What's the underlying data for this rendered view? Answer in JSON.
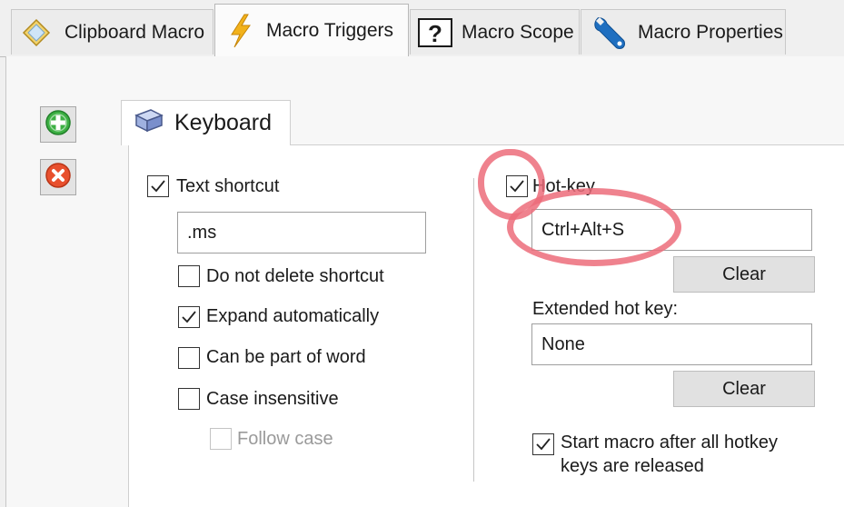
{
  "tabs": [
    {
      "label": "Clipboard Macro",
      "icon": "diamond-icon",
      "active": false
    },
    {
      "label": "Macro Triggers",
      "icon": "lightning-icon",
      "active": true
    },
    {
      "label": "Macro Scope",
      "icon": "question-icon",
      "active": false
    },
    {
      "label": "Macro Properties",
      "icon": "wrench-icon",
      "active": false
    }
  ],
  "sidebar": {
    "add_icon": "plus-circle-icon",
    "remove_icon": "x-circle-icon"
  },
  "inner_tab": {
    "label": "Keyboard",
    "icon": "keyboard-icon"
  },
  "text_shortcut": {
    "label": "Text shortcut",
    "checked": true,
    "value": ".ms",
    "options": [
      {
        "label": "Do not delete shortcut",
        "checked": false
      },
      {
        "label": "Expand automatically",
        "checked": true
      },
      {
        "label": "Can be part of word",
        "checked": false
      },
      {
        "label": "Case insensitive",
        "checked": false
      },
      {
        "label": "Follow case",
        "checked": false,
        "disabled": true
      }
    ]
  },
  "hotkey": {
    "label": "Hot-key",
    "checked": true,
    "value": "Ctrl+Alt+S",
    "clear_label": "Clear",
    "extended_label": "Extended hot key:",
    "extended_value": "None",
    "extended_clear_label": "Clear",
    "start_after_release": {
      "label_line1": "Start macro after all hotkey",
      "label_line2": "keys are released",
      "checked": true
    }
  },
  "colors": {
    "annotation": "#ec6c7a",
    "add_button": "#3cb043",
    "remove_button": "#e8502e"
  }
}
